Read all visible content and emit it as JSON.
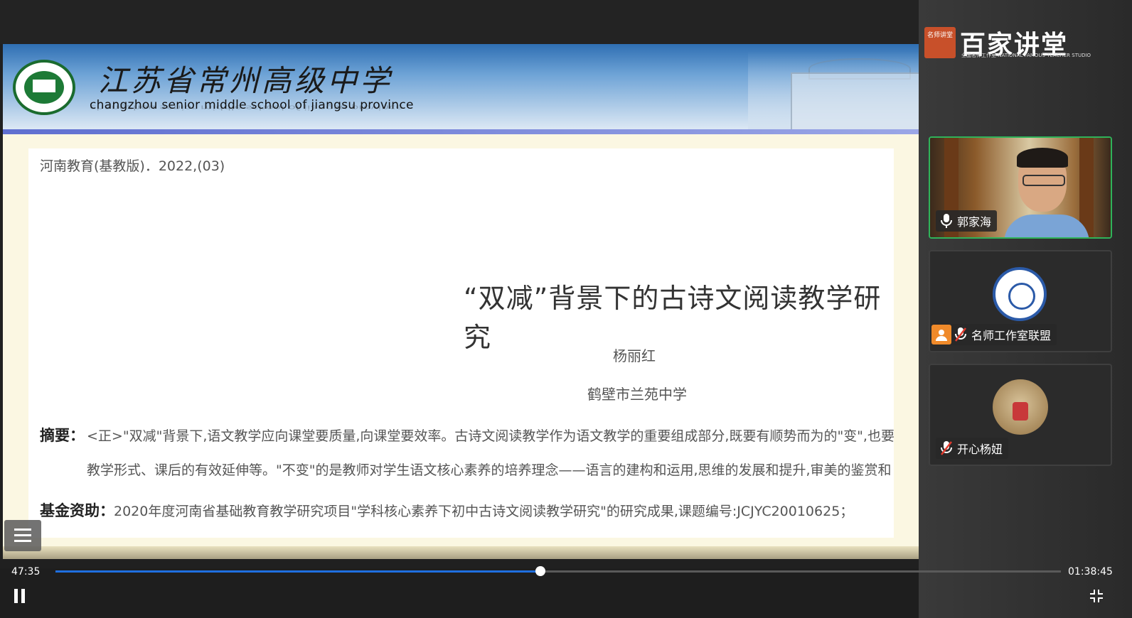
{
  "slide": {
    "school_name_cn": "江苏省常州高级中学",
    "school_name_en": "changzhou senior middle school of jiangsu province",
    "journal": "河南教育(基教版)．2022,(03)",
    "title": "“双减”背景下的古诗文阅读教学研究",
    "author": "杨丽红",
    "affiliation": "鹤壁市兰苑中学",
    "abstract_label": "摘要：",
    "abstract_line1": "<正>\"双减\"背景下,语文教学应向课堂要质量,向课堂要效率。古诗文阅读教学作为语文教学的重要组成部分,既要有顺势而为的\"变\",也要",
    "abstract_line2": "教学形式、课后的有效延伸等。\"不变\"的是教师对学生语文核心素养的培养理念——语言的建构和运用,思维的发展和提升,审美的鉴赏和",
    "fund_label": "基金资助：",
    "fund_text": "2020年度河南省基础教育教学研究项目\"学科核心素养下初中古诗文阅读教学研究\"的研究成果,课题编号:JCJYC20010625；"
  },
  "brand": {
    "title": "百家讲堂",
    "subtitle": "全国名师工作室 NATIONAL FAMOUS TEACHER STUDIO",
    "seal_text": "名师讲堂"
  },
  "participants": [
    {
      "name": "郭家海",
      "mic": "on",
      "active": true
    },
    {
      "name": "名师工作室联盟",
      "mic": "muted",
      "active": false
    },
    {
      "name": "开心杨妞",
      "mic": "muted",
      "active": false
    }
  ],
  "player": {
    "current_time": "47:35",
    "total_time": "01:38:45",
    "progress": 0.482,
    "accent_color": "#1f6fe0"
  },
  "icons": {
    "menu": "list-menu-icon",
    "pause": "pause-icon",
    "exit_fullscreen": "exit-fullscreen-icon",
    "mic_on": "microphone-icon",
    "mic_muted": "microphone-muted-icon",
    "user": "user-avatar-icon"
  }
}
